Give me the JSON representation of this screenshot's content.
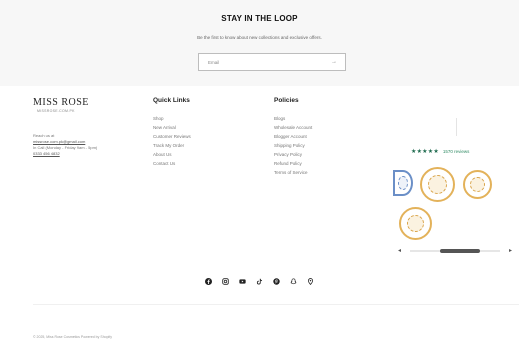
{
  "newsletter": {
    "title": "STAY IN THE LOOP",
    "subtitle": "Be the first to know about new collections and exclusive offers.",
    "email_placeholder": "Email",
    "submit_icon": "arrow-right-icon"
  },
  "brand": {
    "name": "MISS ROSE",
    "url": "MISSROSE.COM.PK"
  },
  "contact": {
    "label": "Reach us at",
    "email": "missrose.com.pk@gmail.com",
    "hours": "In Call (Monday - Friday 9am - 5pm)",
    "phone": "0333 456 4832"
  },
  "quick_links": {
    "title": "Quick Links",
    "items": [
      "Shop",
      "New Arrival",
      "Customer Reviews",
      "Track My Order",
      "About Us",
      "Contact Us"
    ]
  },
  "policies": {
    "title": "Policies",
    "items": [
      "Blogs",
      "Wholesale Account",
      "Blogger Account",
      "Shipping Policy",
      "Privacy Policy",
      "Refund Policy",
      "Terms of Service"
    ]
  },
  "reviews": {
    "stars": "★★★★★",
    "count_label": "1570 reviews",
    "star_color": "#1f6b4f",
    "slider_position": 0.6
  },
  "social": {
    "icons": [
      "facebook-icon",
      "instagram-icon",
      "youtube-icon",
      "tiktok-icon",
      "pinterest-icon",
      "snapchat-icon",
      "location-icon"
    ]
  },
  "footer": {
    "copyright": "© 2025, Miss Rose Cosmetics Powered by Shopify"
  }
}
